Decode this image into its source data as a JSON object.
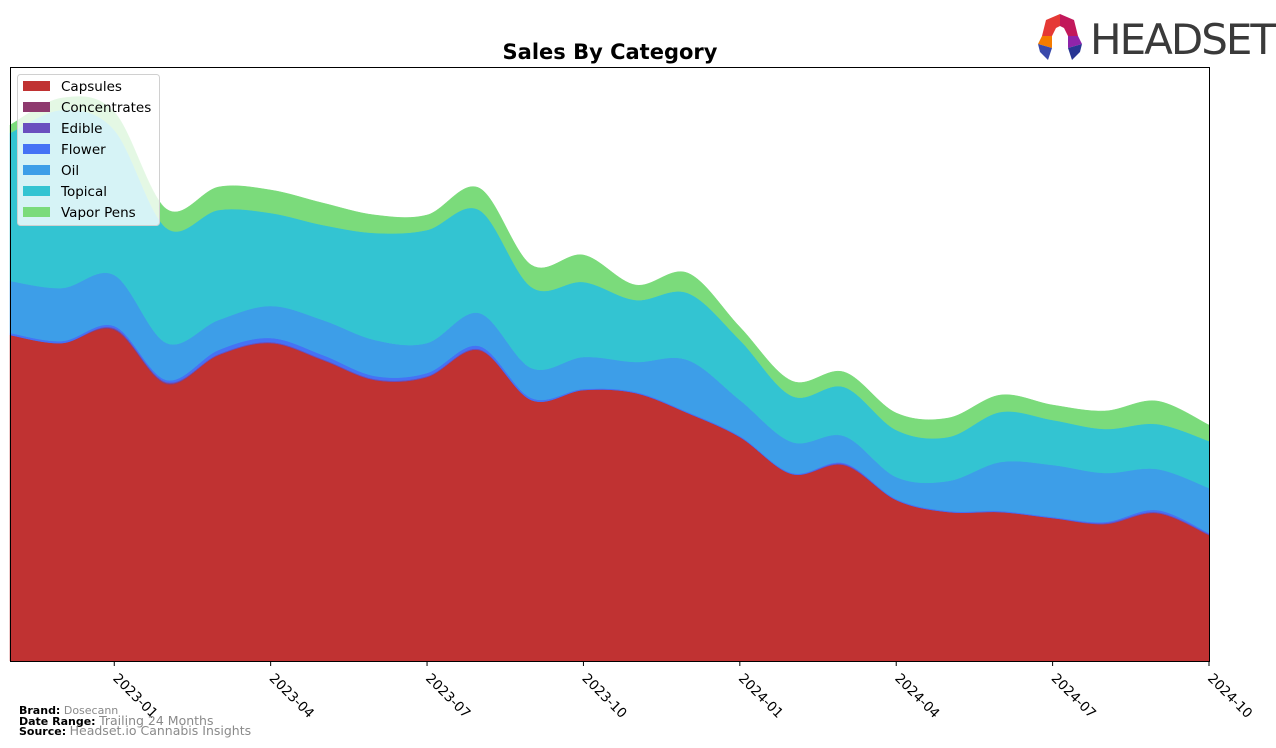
{
  "logo": {
    "text": "HEADSET"
  },
  "chart_data": {
    "type": "area",
    "stacked": true,
    "title": "Sales By Category",
    "xlabel": "",
    "ylabel": "",
    "y_axis_visible": false,
    "y_units": "relative (no y-axis labels shown)",
    "ylim": [
      0,
      594
    ],
    "x": [
      "2022-11",
      "2022-12",
      "2023-01",
      "2023-02",
      "2023-03",
      "2023-04",
      "2023-05",
      "2023-06",
      "2023-07",
      "2023-08",
      "2023-09",
      "2023-10",
      "2023-11",
      "2023-12",
      "2024-01",
      "2024-02",
      "2024-03",
      "2024-04",
      "2024-05",
      "2024-06",
      "2024-07",
      "2024-08",
      "2024-09",
      "2024-10"
    ],
    "xlim": [
      "2022-11",
      "2024-10"
    ],
    "x_tick_labels": [
      "2023-01",
      "2023-04",
      "2023-07",
      "2023-10",
      "2024-01",
      "2024-04",
      "2024-07",
      "2024-10"
    ],
    "legend_position": "top-left",
    "grid": false,
    "series": [
      {
        "name": "Capsules",
        "color": "#c03232",
        "values": [
          326,
          318,
          331,
          277,
          306,
          318,
          301,
          281,
          284,
          311,
          261,
          271,
          268,
          248,
          224,
          187,
          196,
          161,
          149,
          149,
          143,
          137,
          148,
          126
        ]
      },
      {
        "name": "Concentrates",
        "color": "#8e3a6e",
        "values": [
          0,
          0,
          1,
          1,
          0,
          0,
          0,
          0,
          0,
          0,
          0,
          0,
          0,
          0,
          0,
          0,
          0,
          0,
          0,
          0,
          0,
          0,
          0,
          0
        ]
      },
      {
        "name": "Edible",
        "color": "#6a4fbf",
        "values": [
          0,
          0,
          1,
          1,
          1,
          1,
          1,
          1,
          1,
          1,
          0,
          0,
          0,
          0,
          0,
          0,
          1,
          0,
          0,
          0,
          0,
          1,
          1,
          1
        ]
      },
      {
        "name": "Flower",
        "color": "#4572f5",
        "values": [
          2,
          2,
          2,
          2,
          4,
          4,
          4,
          3,
          3,
          3,
          2,
          1,
          1,
          1,
          1,
          1,
          1,
          1,
          1,
          1,
          1,
          1,
          2,
          1
        ]
      },
      {
        "name": "Oil",
        "color": "#3d9ee8",
        "values": [
          52,
          53,
          51,
          37,
          30,
          32,
          35,
          36,
          30,
          33,
          30,
          32,
          30,
          52,
          36,
          31,
          27,
          22,
          30,
          49,
          52,
          49,
          41,
          45
        ]
      },
      {
        "name": "Topical",
        "color": "#33c4d2",
        "values": [
          148,
          178,
          145,
          115,
          110,
          93,
          95,
          107,
          113,
          103,
          81,
          75,
          62,
          67,
          60,
          46,
          49,
          47,
          44,
          50,
          45,
          44,
          45,
          47
        ]
      },
      {
        "name": "Vapor Pens",
        "color": "#7bdb7b",
        "values": [
          8,
          12,
          18,
          19,
          23,
          23,
          22,
          18,
          15,
          22,
          22,
          27,
          15,
          20,
          13,
          15,
          15,
          17,
          19,
          17,
          15,
          18,
          23,
          16
        ]
      }
    ]
  },
  "footer": {
    "brand_label": "Brand:",
    "brand_value": "Dosecann",
    "range_label": "Date Range:",
    "range_value": "Trailing 24 Months",
    "source_label": "Source:",
    "source_value": "Headset.io Cannabis Insights"
  }
}
